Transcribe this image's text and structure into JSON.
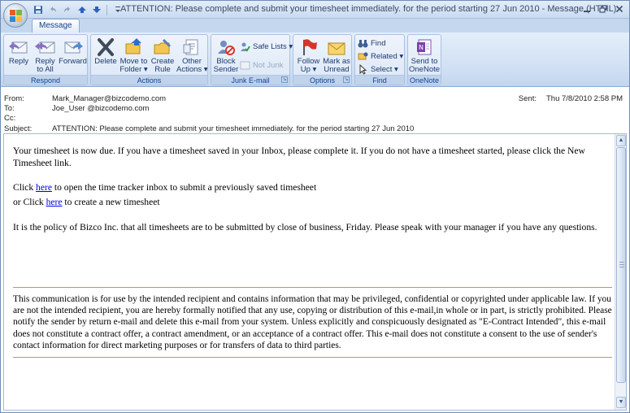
{
  "window": {
    "title": "ATTENTION: Please complete and submit your timesheet immediately. for the period starting 27 Jun 2010 - Message (HTML)"
  },
  "tabs": {
    "message": "Message"
  },
  "ribbon": {
    "respond": {
      "label": "Respond",
      "reply": "Reply",
      "reply_all_1": "Reply",
      "reply_all_2": "to All",
      "forward": "Forward"
    },
    "actions": {
      "label": "Actions",
      "delete": "Delete",
      "move_1": "Move to",
      "move_2": "Folder ▾",
      "create_rule_1": "Create",
      "create_rule_2": "Rule",
      "other_1": "Other",
      "other_2": "Actions ▾"
    },
    "junk": {
      "label": "Junk E-mail",
      "block_1": "Block",
      "block_2": "Sender",
      "safe_lists": "Safe Lists ▾",
      "not_junk": "Not Junk"
    },
    "options": {
      "label": "Options",
      "follow_1": "Follow",
      "follow_2": "Up ▾",
      "mark_1": "Mark as",
      "mark_2": "Unread"
    },
    "find": {
      "label": "Find",
      "find": "Find",
      "related": "Related ▾",
      "select": "Select ▾"
    },
    "onenote": {
      "label": "OneNote",
      "send_1": "Send to",
      "send_2": "OneNote"
    }
  },
  "header": {
    "from_label": "From:",
    "from": "Mark_Manager@bizcodemo.com",
    "to_label": "To:",
    "to": "Joe_User @bizcodemo.com",
    "cc_label": "Cc:",
    "cc": "",
    "subject_label": "Subject:",
    "subject": "ATTENTION: Please complete and submit your timesheet immediately. for the period starting 27 Jun 2010",
    "sent_label": "Sent:",
    "sent": "Thu 7/8/2010 2:58 PM"
  },
  "body": {
    "p1": "Your timesheet is now due. If you have a timesheet saved in your Inbox, please complete it. If you do not have a timesheet started, please click the New Timesheet link.",
    "l1_pre": "Click ",
    "l1_link": "here",
    "l1_post": " to open the time tracker inbox to submit a previously saved timesheet",
    "l2_pre": "or Click ",
    "l2_link": "here",
    "l2_post": " to create a new timesheet",
    "p3": "It is the policy of Bizco Inc. that all timesheets are to be submitted by close of business, Friday. Please speak with your manager if you have any questions.",
    "disclaimer": "This communication is for use by the intended recipient and contains information that may be privileged, confidential or copyrighted under applicable law. If you are not the intended recipient, you are hereby formally notified that any use, copying or distribution of this e-mail,in whole or in part, is strictly prohibited. Please notify the sender by return e-mail and delete this e-mail from your system. Unless explicitly and conspicuously designated as \"E-Contract Intended\", this e-mail does not constitute a contract offer, a contract amendment, or an acceptance of a contract offer. This e-mail does not constitute a consent to the use of sender's contact information for direct marketing purposes or for transfers of data to third parties."
  },
  "colors": {
    "ribbon_text": "#15428b",
    "link": "#0000ee",
    "frame": "#6f8db5"
  }
}
